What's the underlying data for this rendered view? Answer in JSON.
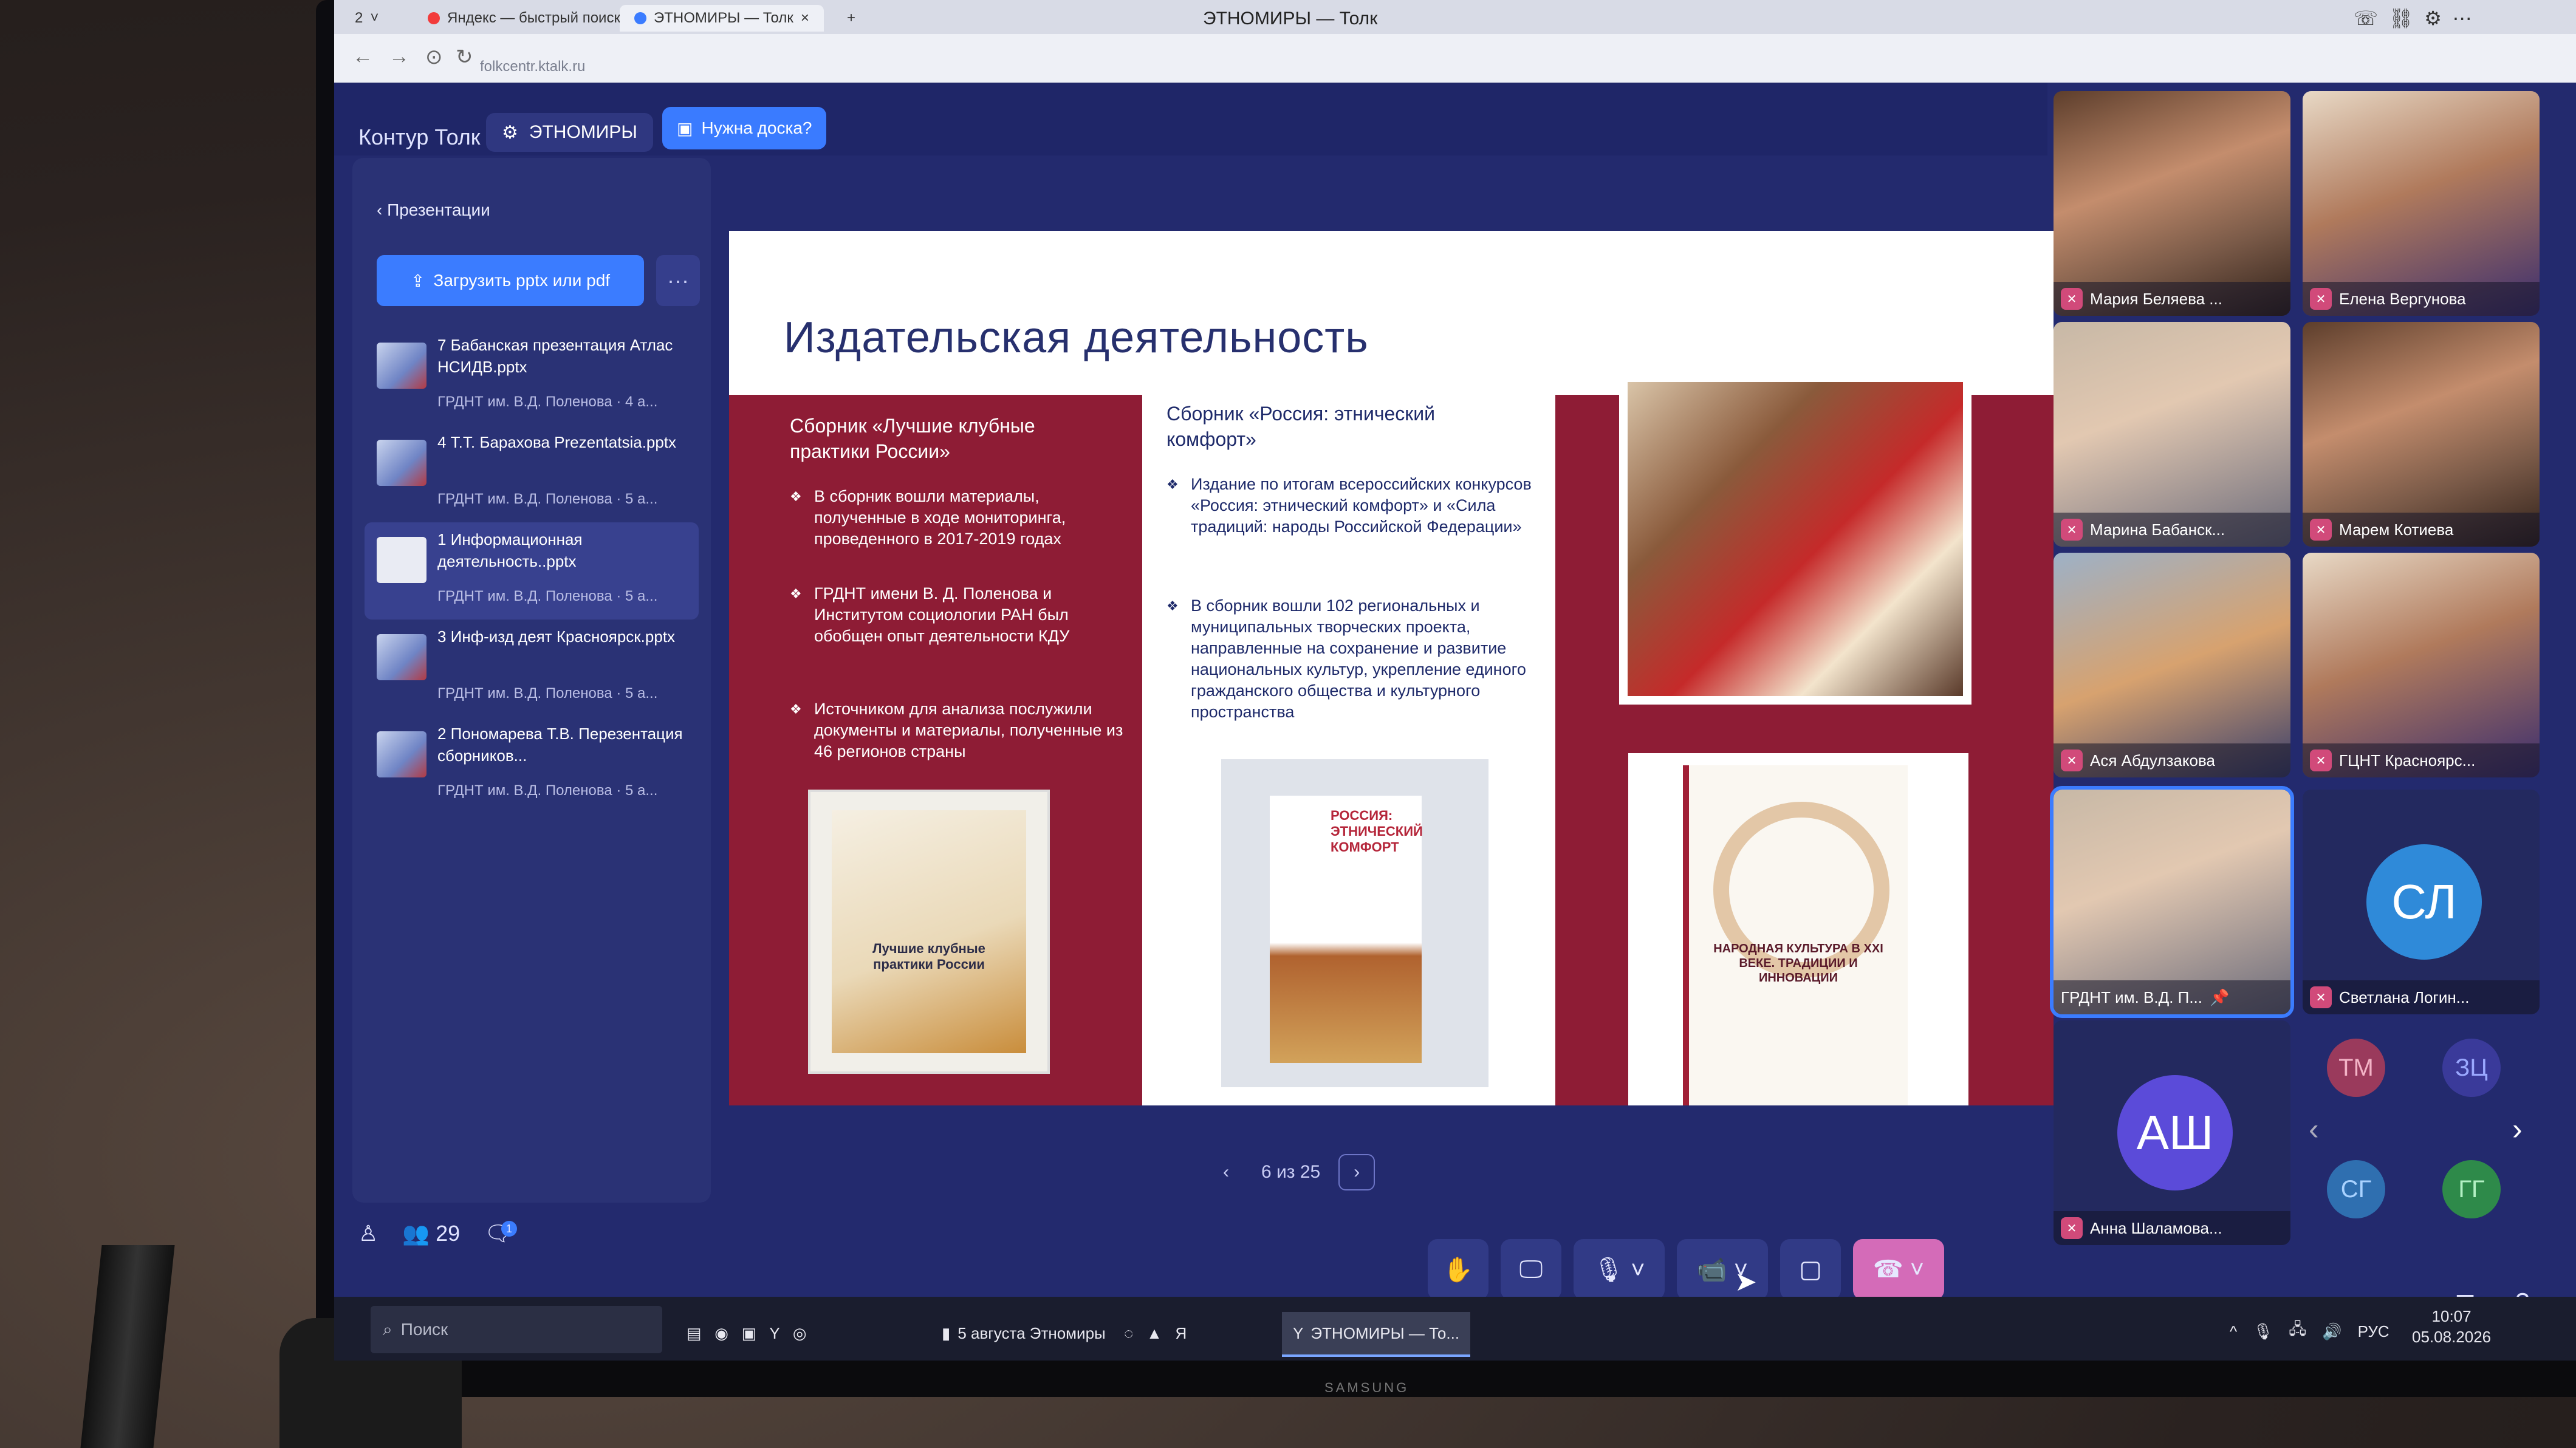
{
  "browser": {
    "tab_count": "2",
    "tabs": [
      {
        "label": "Яндекс — быстрый поиск"
      },
      {
        "label": "ЭТНОМИРЫ — Толк"
      }
    ],
    "window_title": "ЭТНОМИРЫ — Толк",
    "url": "folkcentr.ktalk.ru"
  },
  "header": {
    "brand": "Контур Толк",
    "conference": "ЭТНОМИРЫ",
    "board_button": "Нужна доска?"
  },
  "panel": {
    "back_label": "Презентации",
    "upload_label": "Загрузить pptx или pdf",
    "more_label": "···",
    "files": [
      {
        "name": "7 Бабанская презентация Атлас НСИДВ.pptx",
        "meta": "ГРДНТ им. В.Д. Поленова · 4 а..."
      },
      {
        "name": "4 Т.Т. Барахова Prezentatsia.pptx",
        "meta": "ГРДНТ им. В.Д. Поленова · 5 а..."
      },
      {
        "name": "1 Информационная деятельность..pptx",
        "meta": "ГРДНТ им. В.Д. Поленова · 5 а..."
      },
      {
        "name": "3 Инф-изд деят Красноярск.pptx",
        "meta": "ГРДНТ им. В.Д. Поленова · 5 а..."
      },
      {
        "name": "2 Пономарева Т.В. Перезентация сборников...",
        "meta": "ГРДНТ им. В.Д. Поленова · 5 а..."
      }
    ]
  },
  "slide": {
    "title": "Издательская  деятельность",
    "col1_head": "Сборник «Лучшие клубные практики России»",
    "col1_bullets": [
      "В сборник вошли материалы, полученные в ходе мониторинга, проведенного в 2017-2019 годах",
      "ГРДНТ имени В. Д. Поленова и Институтом социологии РАН был обобщен опыт деятельности КДУ",
      "Источником для анализа послужили документы и материалы, полученные из 46 регионов страны"
    ],
    "col2_head": "Сборник «Россия: этнический комфорт»",
    "col2_bullets": [
      "Издание по итогам всероссийских конкурсов «Россия: этнический комфорт» и «Сила традиций: народы Российской Федерации»",
      "В сборник вошли 102 региональных и муниципальных творческих проекта, направленные на сохранение  и развитие национальных культур, укрепление единого гражданского общества и культурного пространства"
    ],
    "book1_text": "Лучшие клубные практики России",
    "book2_text": "РОССИЯ: ЭТНИЧЕСКИЙ КОМФОРТ",
    "book3_text": "НАРОДНАЯ КУЛЬТУРА В XXI ВЕКЕ. ТРАДИЦИИ И ИННОВАЦИИ",
    "pager": "6 из 25"
  },
  "bottom": {
    "participants": "29",
    "chat_badge": "1"
  },
  "participants": [
    {
      "name": "Мария Беляева ..."
    },
    {
      "name": "Елена Вергунова"
    },
    {
      "name": "Марина Бабанск..."
    },
    {
      "name": "Марем Котиева"
    },
    {
      "name": "Ася Абдулзакова"
    },
    {
      "name": "ГЦНТ Краснояpс..."
    },
    {
      "name": "ГРДНТ им. В.Д. П..."
    },
    {
      "name": "Светлана Логин...",
      "initials": "СЛ"
    },
    {
      "name": "Анна Шаламова...",
      "initials": "АШ"
    }
  ],
  "mini_avatars": [
    "ТМ",
    "ЗЦ",
    "СГ",
    "ГГ"
  ],
  "taskbar": {
    "search": "Поиск",
    "items": [
      "5 августа Этномиры",
      "ЭТНОМИРЫ — То..."
    ],
    "lang": "РУС",
    "time": "10:07",
    "date": "05.08.2026"
  },
  "monitor_brand": "SAMSUNG"
}
